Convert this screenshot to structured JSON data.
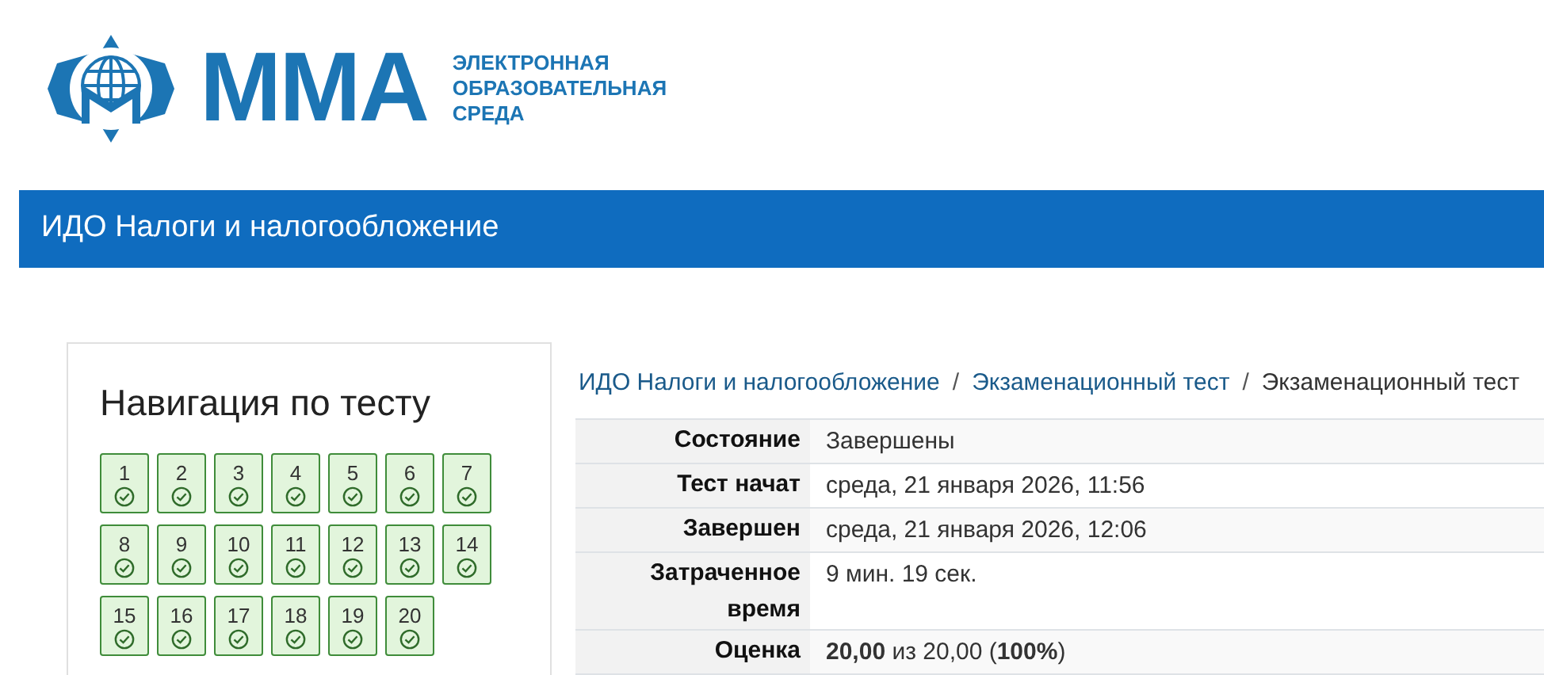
{
  "logo": {
    "name": "ММА",
    "subtitle": [
      "ЭЛЕКТРОННАЯ",
      "ОБРАЗОВАТЕЛЬНАЯ",
      "СРЕДА"
    ]
  },
  "header": {
    "title": "ИДО Налоги и налогообложение"
  },
  "navigation": {
    "title": "Навигация по тесту",
    "questions": [
      {
        "label": "1",
        "correct": true
      },
      {
        "label": "2",
        "correct": true
      },
      {
        "label": "3",
        "correct": true
      },
      {
        "label": "4",
        "correct": true
      },
      {
        "label": "5",
        "correct": true
      },
      {
        "label": "6",
        "correct": true
      },
      {
        "label": "7",
        "correct": true
      },
      {
        "label": "8",
        "correct": true
      },
      {
        "label": "9",
        "correct": true
      },
      {
        "label": "10",
        "correct": true
      },
      {
        "label": "11",
        "correct": true
      },
      {
        "label": "12",
        "correct": true
      },
      {
        "label": "13",
        "correct": true
      },
      {
        "label": "14",
        "correct": true
      },
      {
        "label": "15",
        "correct": true
      },
      {
        "label": "16",
        "correct": true
      },
      {
        "label": "17",
        "correct": true
      },
      {
        "label": "18",
        "correct": true
      },
      {
        "label": "19",
        "correct": true
      },
      {
        "label": "20",
        "correct": true
      }
    ]
  },
  "breadcrumb": [
    {
      "label": "ИДО Налоги и налогообложение",
      "link": true
    },
    {
      "label": "Экзаменационный тест",
      "link": true
    },
    {
      "label": "Экзаменационный тест",
      "link": false
    }
  ],
  "breadcrumb_separator": "/",
  "summary": [
    {
      "label": "Состояние",
      "value": "Завершены"
    },
    {
      "label": "Тест начат",
      "value": "среда, 21 января 2026, 11:56"
    },
    {
      "label": "Завершен",
      "value": "среда, 21 января 2026, 12:06"
    },
    {
      "label": "Затраченное время",
      "value": "9 мин. 19 сек."
    },
    {
      "label": "Оценка",
      "value": "**20,00** из 20,00 (**100%**)"
    }
  ]
}
